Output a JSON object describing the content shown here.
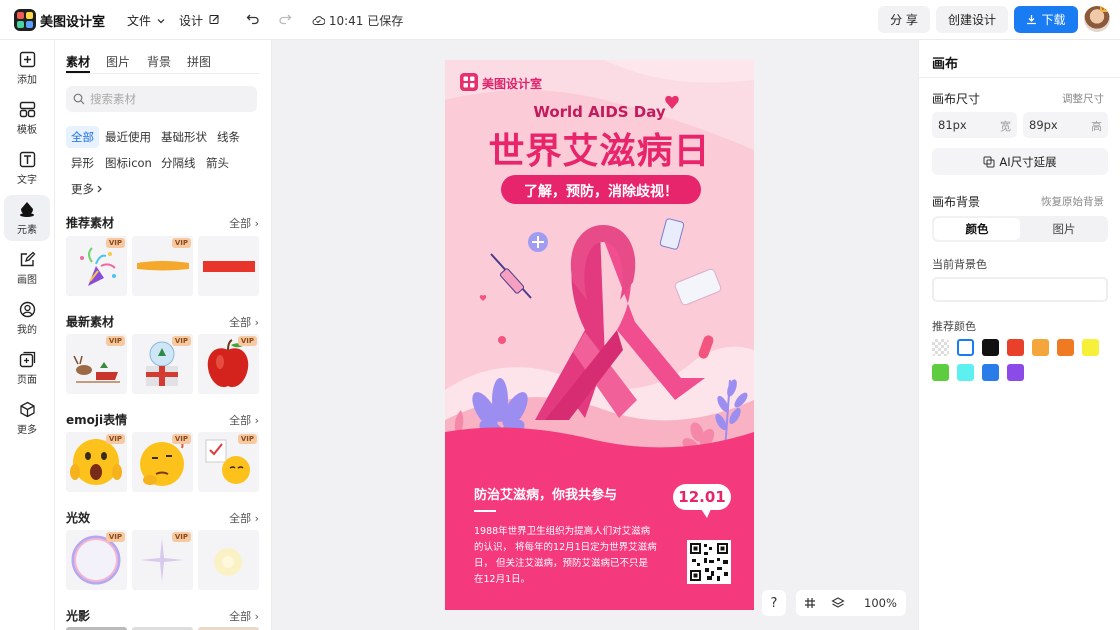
{
  "topbar": {
    "app_name": "美图设计室",
    "menu_file": "文件",
    "menu_design": "设计",
    "save_status": "10:41 已保存",
    "share_label": "分 享",
    "create_label": "创建设计",
    "download_label": "下载"
  },
  "leftnav": {
    "items": [
      {
        "label": "添加",
        "icon": "plus-square-icon"
      },
      {
        "label": "模板",
        "icon": "template-icon"
      },
      {
        "label": "文字",
        "icon": "text-icon"
      },
      {
        "label": "元素",
        "icon": "shapes-icon"
      },
      {
        "label": "画图",
        "icon": "pencil-icon"
      },
      {
        "label": "我的",
        "icon": "user-icon"
      },
      {
        "label": "页面",
        "icon": "page-add-icon"
      },
      {
        "label": "更多",
        "icon": "cube-icon"
      }
    ],
    "active_index": 3
  },
  "panel": {
    "tabs": [
      "素材",
      "图片",
      "背景",
      "拼图"
    ],
    "search_placeholder": "搜索素材",
    "chips": [
      "全部",
      "最近使用",
      "基础形状",
      "线条",
      "异形",
      "图标icon",
      "分隔线",
      "箭头",
      "更多"
    ],
    "all_label": "全部",
    "vip_label": "VIP",
    "sections": [
      {
        "title": "推荐素材"
      },
      {
        "title": "最新素材"
      },
      {
        "title": "emoji表情"
      },
      {
        "title": "光效"
      },
      {
        "title": "光影"
      }
    ]
  },
  "poster": {
    "brand": "美图设计室",
    "english_title": "World AIDS Day",
    "title": "世界艾滋病日",
    "subtitle": "了解，预防，消除歧视！",
    "slogan": "防治艾滋病，你我共参与",
    "date": "12.01",
    "body_text": "1988年世界卫生组织为提高人们对艾滋病的认识， 将每年的12月1日定为世界艾滋病日， 但关注艾滋病，预防艾滋病已不只是在12月1日。"
  },
  "bottom_toolbar": {
    "help": "?",
    "zoom": "100%"
  },
  "rightpanel": {
    "title": "画布",
    "size_label": "画布尺寸",
    "resize_label": "调整尺寸",
    "width_value": "81px",
    "width_unit": "宽",
    "height_value": "89px",
    "height_unit": "高",
    "ai_extend_label": "AI尺寸延展",
    "bg_label": "画布背景",
    "restore_label": "恢复原始背景",
    "bg_tabs": [
      "颜色",
      "图片"
    ],
    "current_bg_label": "当前背景色",
    "recommended_label": "推荐颜色",
    "colors": [
      "transparent",
      "#ffffff",
      "#111111",
      "#e8402a",
      "#f4a63c",
      "#ef7a22",
      "#f7f03a",
      "#5dcc3e",
      "#5ef0f0",
      "#2a7de8",
      "#8b4be8"
    ]
  }
}
